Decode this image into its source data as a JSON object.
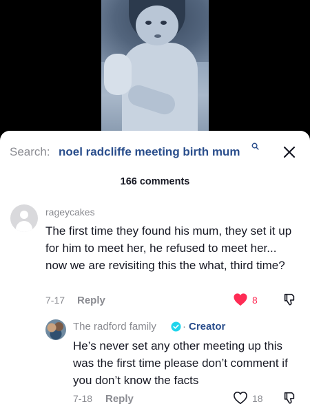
{
  "search": {
    "label": "Search:",
    "query": "noel radcliffe meeting birth mum"
  },
  "comments_header": {
    "count_text": "166 comments"
  },
  "comments": [
    {
      "username": "rageycakes",
      "text": "The first time they found his mum, they set it up for him to meet her, he refused to meet her... now we are revisiting this the what, third time?",
      "date": "7-17",
      "reply_label": "Reply",
      "likes": "8",
      "liked": true,
      "replies": [
        {
          "username": "The radford family",
          "badge_separator": "·",
          "role": "Creator",
          "text": "He’s never set any other meeting up this was the first time please don’t comment if you don’t know the facts",
          "date": "7-18",
          "reply_label": "Reply",
          "likes": "18",
          "liked": false
        }
      ]
    }
  ],
  "colors": {
    "liked": "#fe2c55",
    "link": "#2a4e8c",
    "muted": "#8a8b91",
    "text": "#161823",
    "verified": "#20d5ec"
  },
  "icons": {
    "close": "close-icon",
    "search": "search-icon",
    "like": "heart-icon",
    "dislike": "thumbs-down-icon",
    "verified": "verified-badge-icon"
  }
}
